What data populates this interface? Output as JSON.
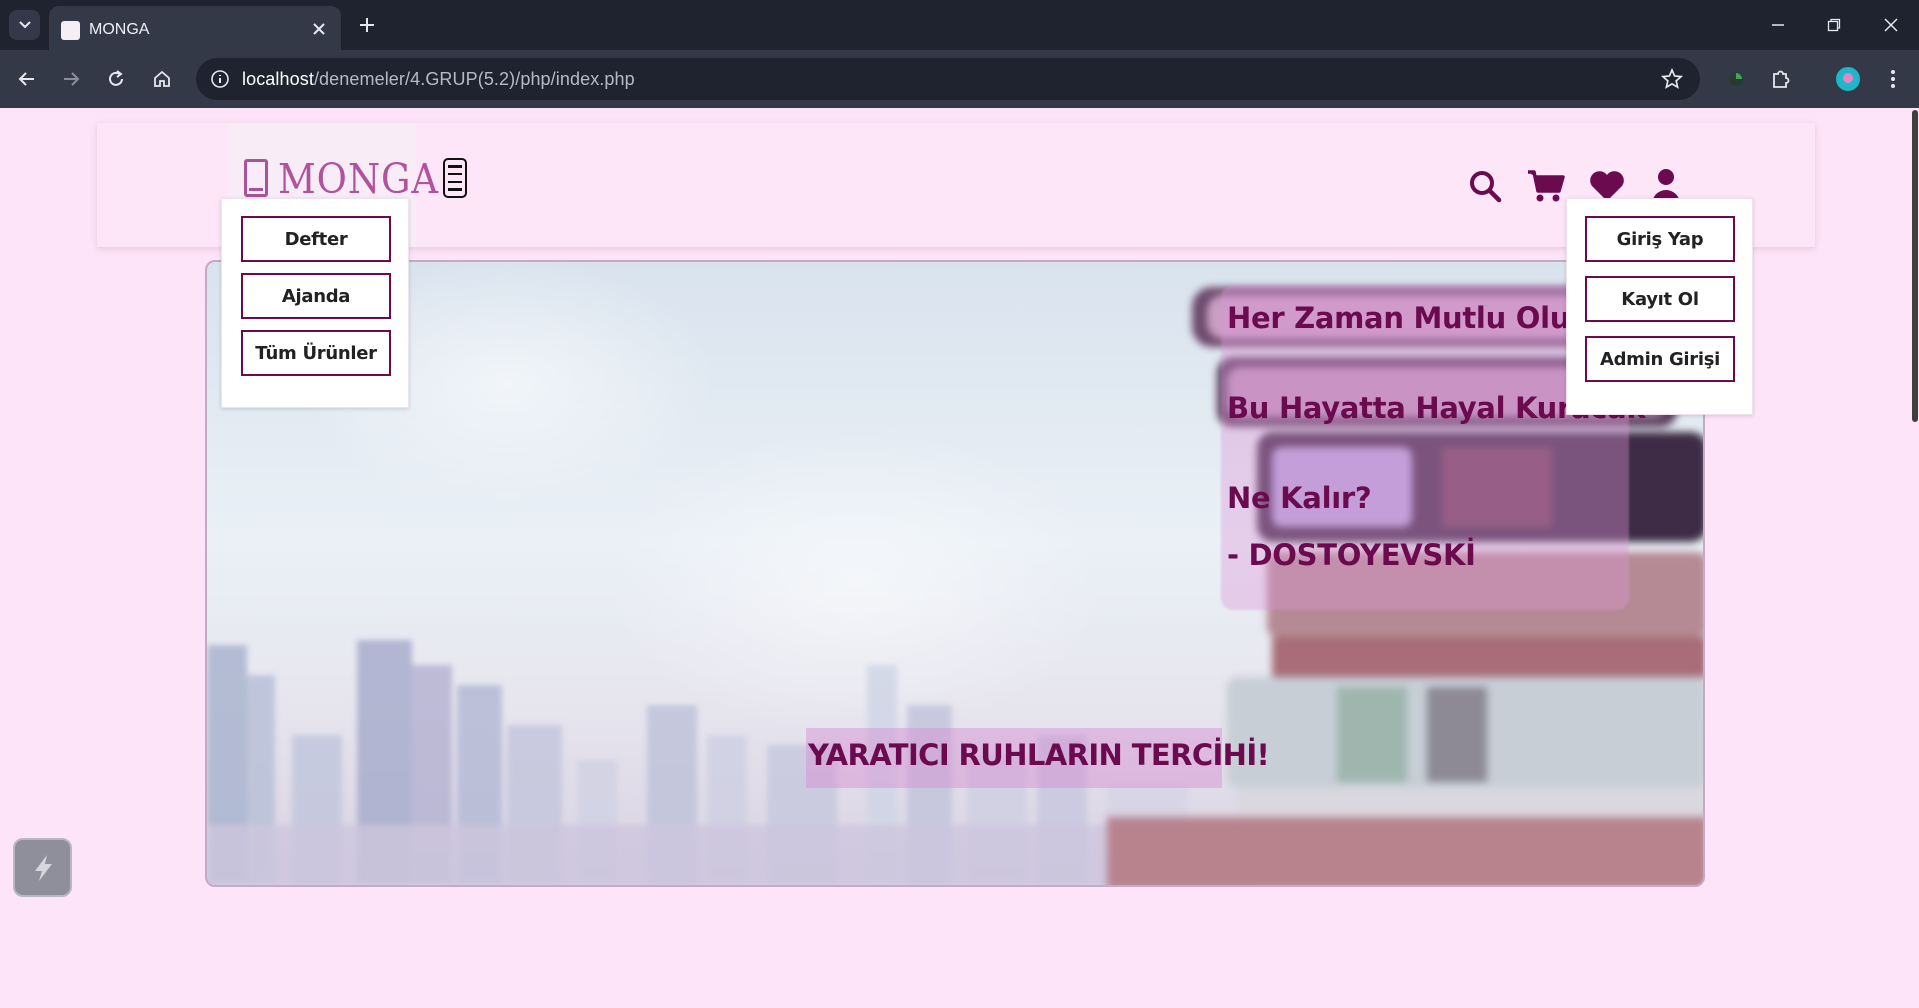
{
  "browser": {
    "tab_title": "MONGA",
    "url_host": "localhost",
    "url_path": "/denemeler/4.GRUP(5.2)/php/index.php"
  },
  "site": {
    "logo_text": "MONGA",
    "category_menu": [
      "Defter",
      "Ajanda",
      "Tüm Ürünler"
    ],
    "account_menu": [
      "Giriş Yap",
      "Kayıt Ol",
      "Admin Girişi"
    ],
    "hero": {
      "quote_lines": [
        "Her Zaman Mutlu Olursak",
        "Bu Hayatta Hayal Kuracak",
        "Ne Kalır?",
        "- DOSTOYEVSKİ"
      ],
      "tagline": "YARATICI RUHLARIN TERCİHİ!"
    },
    "colors": {
      "accent": "#6b0a4f",
      "logo": "#b1529d",
      "page_background": "#fde4f8"
    },
    "header_icons": [
      "search-icon",
      "cart-icon",
      "heart-icon",
      "user-icon"
    ]
  }
}
